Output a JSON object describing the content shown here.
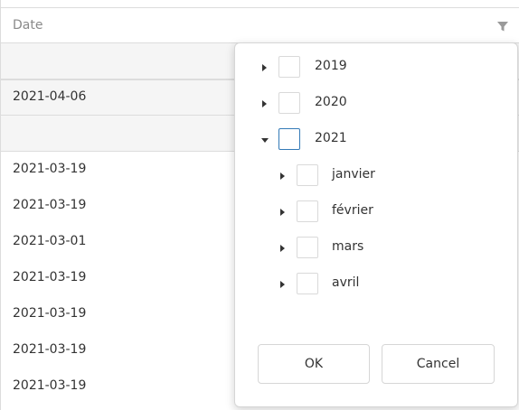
{
  "grid": {
    "column_header": "Date",
    "group_rows": [
      "",
      "2021-04-06",
      ""
    ],
    "rows": [
      "2021-03-19",
      "2021-03-19",
      "2021-03-01",
      "2021-03-19",
      "2021-03-19",
      "2021-03-19",
      "2021-03-19"
    ]
  },
  "filter_popup": {
    "years": [
      {
        "label": "2019",
        "expanded": false
      },
      {
        "label": "2020",
        "expanded": false
      },
      {
        "label": "2021",
        "expanded": true
      }
    ],
    "months": [
      {
        "label": "janvier"
      },
      {
        "label": "février"
      },
      {
        "label": "mars"
      },
      {
        "label": "avril"
      }
    ],
    "ok_label": "OK",
    "cancel_label": "Cancel"
  },
  "colors": {
    "border": "#dcdcdc",
    "group_background": "#f5f5f5",
    "focus_accent": "#337ab7",
    "header_text": "#8a8a8a"
  },
  "icons": {
    "header_filter": "filter-icon",
    "collapsed": "caret-right-icon",
    "expanded": "caret-down-icon"
  }
}
